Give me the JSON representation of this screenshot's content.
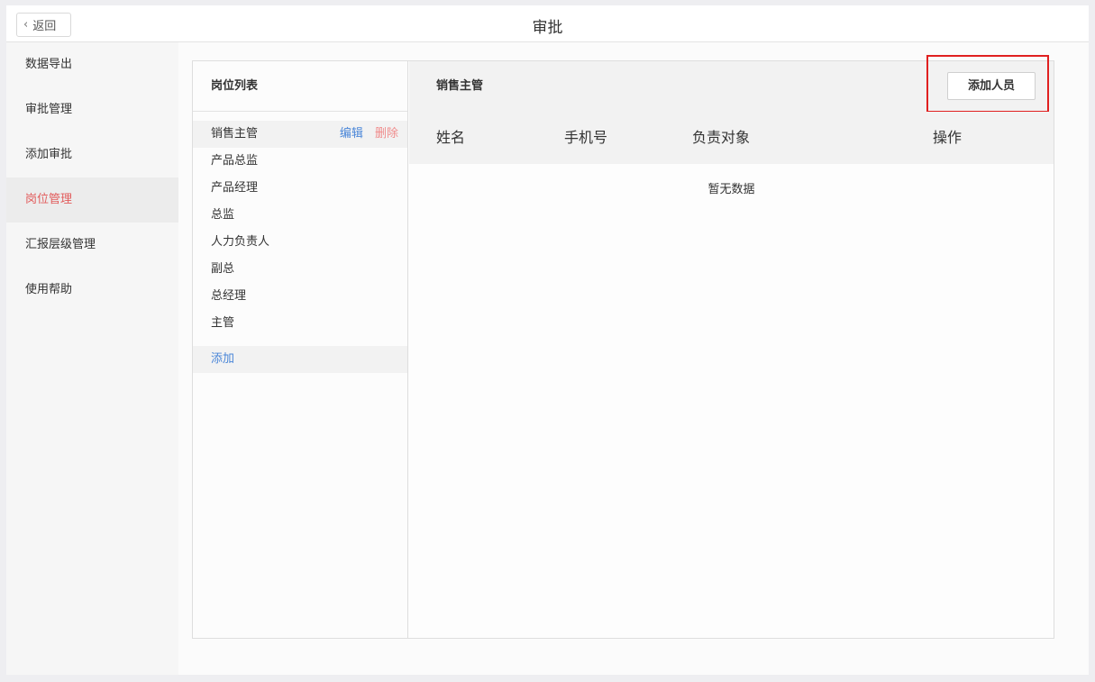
{
  "topbar": {
    "back_label": "返回",
    "title": "审批"
  },
  "sidebar": {
    "items": [
      {
        "label": "数据导出",
        "active": false
      },
      {
        "label": "审批管理",
        "active": false
      },
      {
        "label": "添加审批",
        "active": false
      },
      {
        "label": "岗位管理",
        "active": true
      },
      {
        "label": "汇报层级管理",
        "active": false
      },
      {
        "label": "使用帮助",
        "active": false
      }
    ]
  },
  "positions": {
    "header": "岗位列表",
    "items": [
      {
        "label": "销售主管",
        "selected": true
      },
      {
        "label": "产品总监"
      },
      {
        "label": "产品经理"
      },
      {
        "label": "总监"
      },
      {
        "label": "人力负责人"
      },
      {
        "label": "副总"
      },
      {
        "label": "总经理"
      },
      {
        "label": "主管"
      }
    ],
    "edit_label": "编辑",
    "delete_label": "删除",
    "add_label": "添加"
  },
  "detail": {
    "title": "销售主管",
    "add_member_label": "添加人员",
    "columns": [
      "姓名",
      "手机号",
      "负责对象",
      "操作"
    ],
    "empty_text": "暂无数据"
  },
  "colors": {
    "active_nav": "#e25b5b",
    "link_blue": "#4a86d8",
    "delete_red": "#f08b8b",
    "highlight": "#e02020"
  }
}
